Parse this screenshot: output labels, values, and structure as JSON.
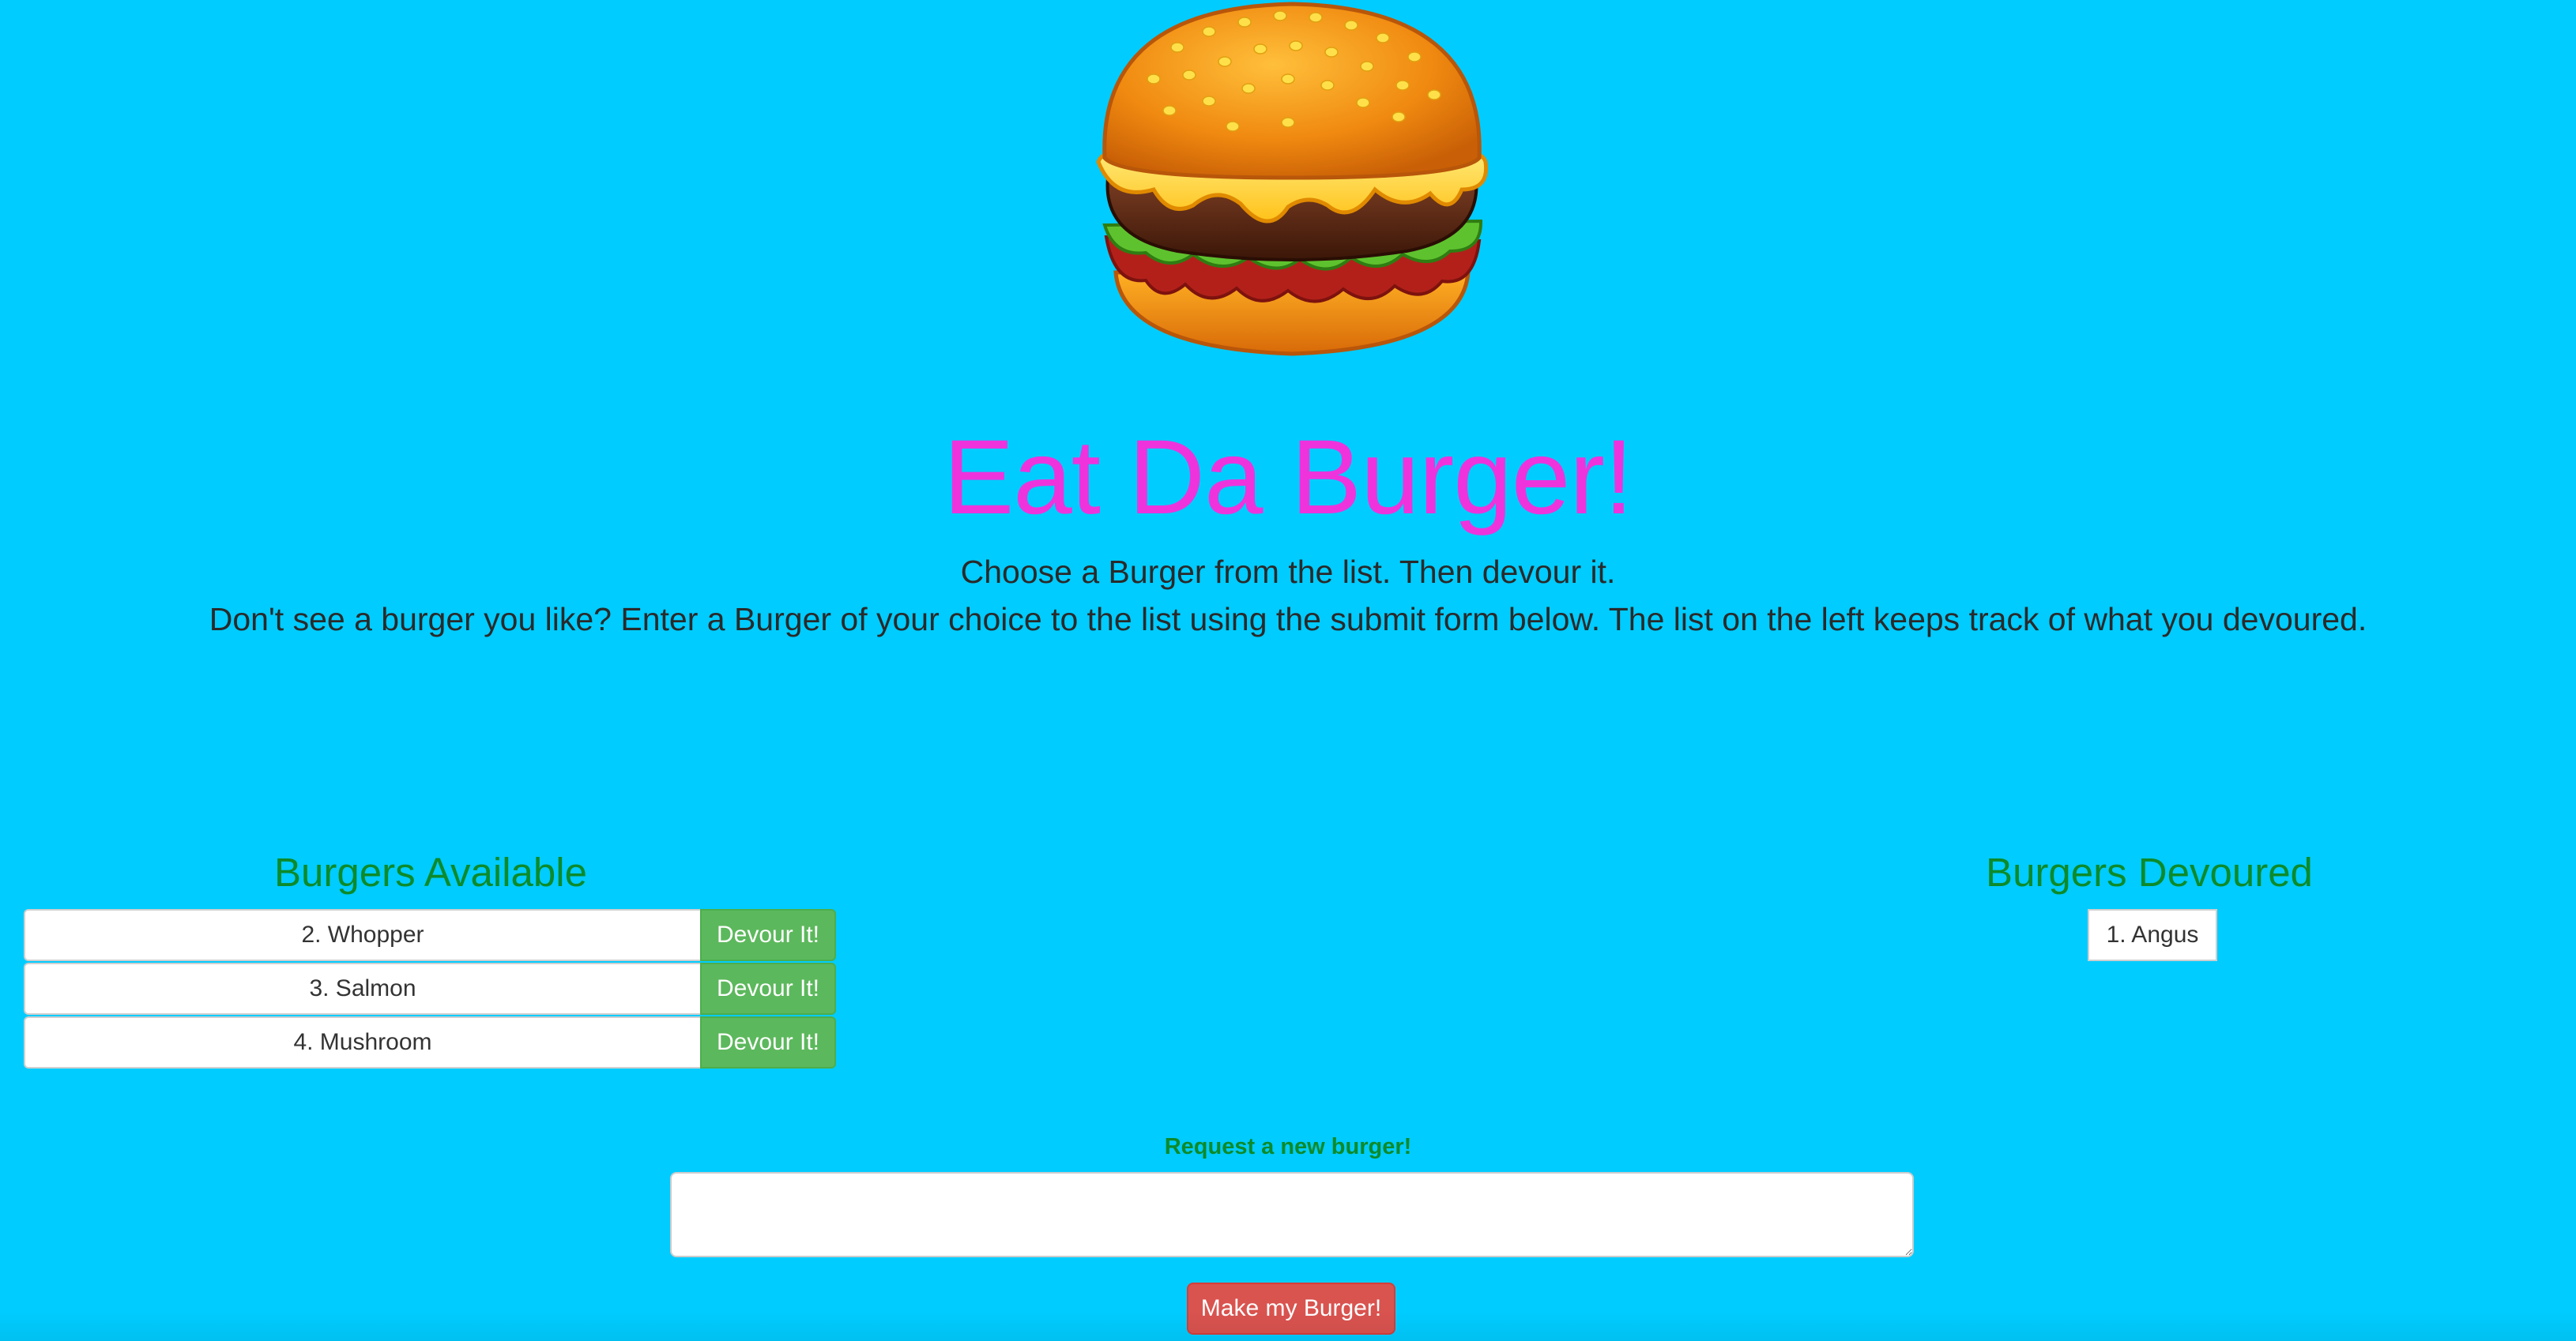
{
  "logo": {
    "icon": "burger-icon"
  },
  "header": {
    "title": "Eat Da Burger!",
    "subtitle_1": "Choose a Burger from the list. Then devour it.",
    "subtitle_2": "Don't see a burger you like? Enter a Burger of your choice to the list using the submit form below. The list on the left keeps track of what you devoured."
  },
  "available": {
    "heading": "Burgers Available",
    "items": [
      {
        "label": "2. Whopper",
        "button": "Devour It!"
      },
      {
        "label": "3. Salmon",
        "button": "Devour It!"
      },
      {
        "label": "4. Mushroom",
        "button": "Devour It!"
      }
    ]
  },
  "devoured": {
    "heading": "Burgers Devoured",
    "items": [
      {
        "label": "1. Angus"
      }
    ]
  },
  "form": {
    "label": "Request a new burger!",
    "value": "",
    "button": "Make my Burger!"
  },
  "colors": {
    "background": "#00ccff",
    "title": "#ee33dd",
    "heading": "#0d8a2a",
    "devour_button": "#5cb85c",
    "make_button": "#d9534f"
  }
}
